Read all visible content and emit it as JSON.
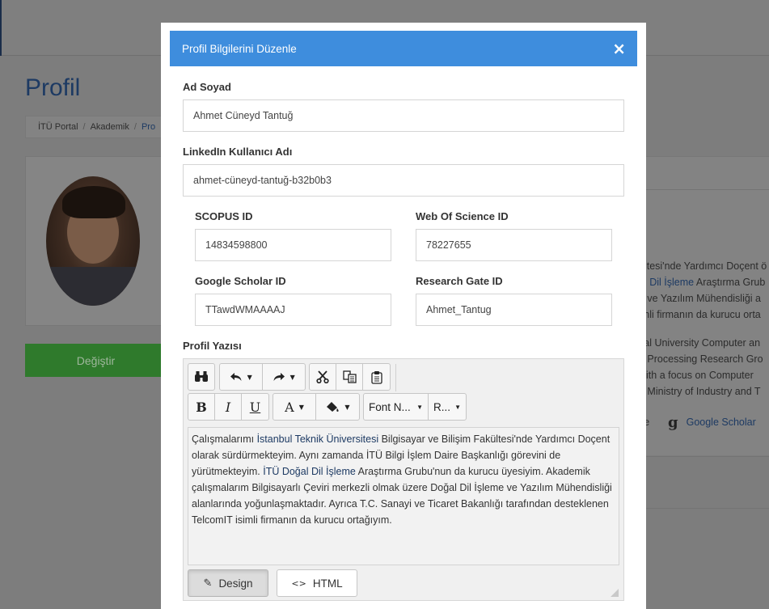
{
  "background": {
    "page_title": "Profil",
    "breadcrumb": [
      "İTÜ Portal",
      "Akademik",
      "Pro"
    ],
    "change_button": "Değiştir",
    "bio_fragments": [
      "ültesi'nde Yardımcı Doçent ö",
      "al Dil İşleme",
      " Araştırma Grub",
      "e ve Yazılım Mühendisliği a",
      "imli firmanın da kurucu orta",
      "cal University Computer an",
      "e Processing Research Gro",
      "with a focus on Computer",
      "e Ministry of Industry and T"
    ],
    "link_ce": "ce",
    "link_scholar": "Google Scholar"
  },
  "modal": {
    "title": "Profil Bilgilerini Düzenle",
    "close_symbol": "×",
    "fields": {
      "name": {
        "label": "Ad Soyad",
        "value": "Ahmet Cüneyd Tantuğ"
      },
      "linkedin": {
        "label": "LinkedIn Kullanıcı Adı",
        "value": "ahmet-cüneyd-tantuğ-b32b0b3"
      },
      "scopus": {
        "label": "SCOPUS ID",
        "value": "14834598800"
      },
      "wos": {
        "label": "Web Of Science ID",
        "value": "78227655"
      },
      "scholar": {
        "label": "Google Scholar ID",
        "value": "TTawdWMAAAAJ"
      },
      "researchgate": {
        "label": "Research Gate ID",
        "value": "Ahmet_Tantug"
      }
    },
    "bio_label": "Profil Yazısı",
    "editor": {
      "bold": "B",
      "italic": "I",
      "underline": "U",
      "font_color": "A",
      "font_name": "Font N...",
      "font_size": "R...",
      "content": {
        "p1a": "Çalışmalarımı ",
        "p1link": "İstanbul Teknik Üniversitesi",
        "p1b": " Bilgisayar ve Bilişim Fakültesi'nde Yardımcı Doçent olarak sürdürmekteyim. Aynı zamanda İTÜ Bilgi İşlem Daire Başkanlığı görevini de yürütmekteyim. ",
        "p1link2": "İTÜ Doğal Dil İşleme",
        "p1c": " Araştırma Grubu'nun da kurucu üyesiyim. Akademik çalışmalarım Bilgisayarlı Çeviri merkezli olmak üzere Doğal Dil İşleme ve Yazılım Mühendisliği alanlarında yoğunlaşmaktadır. Ayrıca T.C. Sanayi ve Ticaret Bakanlığı tarafından desteklenen TelcomIT isimli firmanın da kurucu ortağıyım."
      },
      "design_button": "Design",
      "html_button": "HTML"
    }
  },
  "colors": {
    "header_blue": "#3e8ddd",
    "overlay_gray": "#7f7f7f",
    "link_navy": "#1d3a63"
  }
}
